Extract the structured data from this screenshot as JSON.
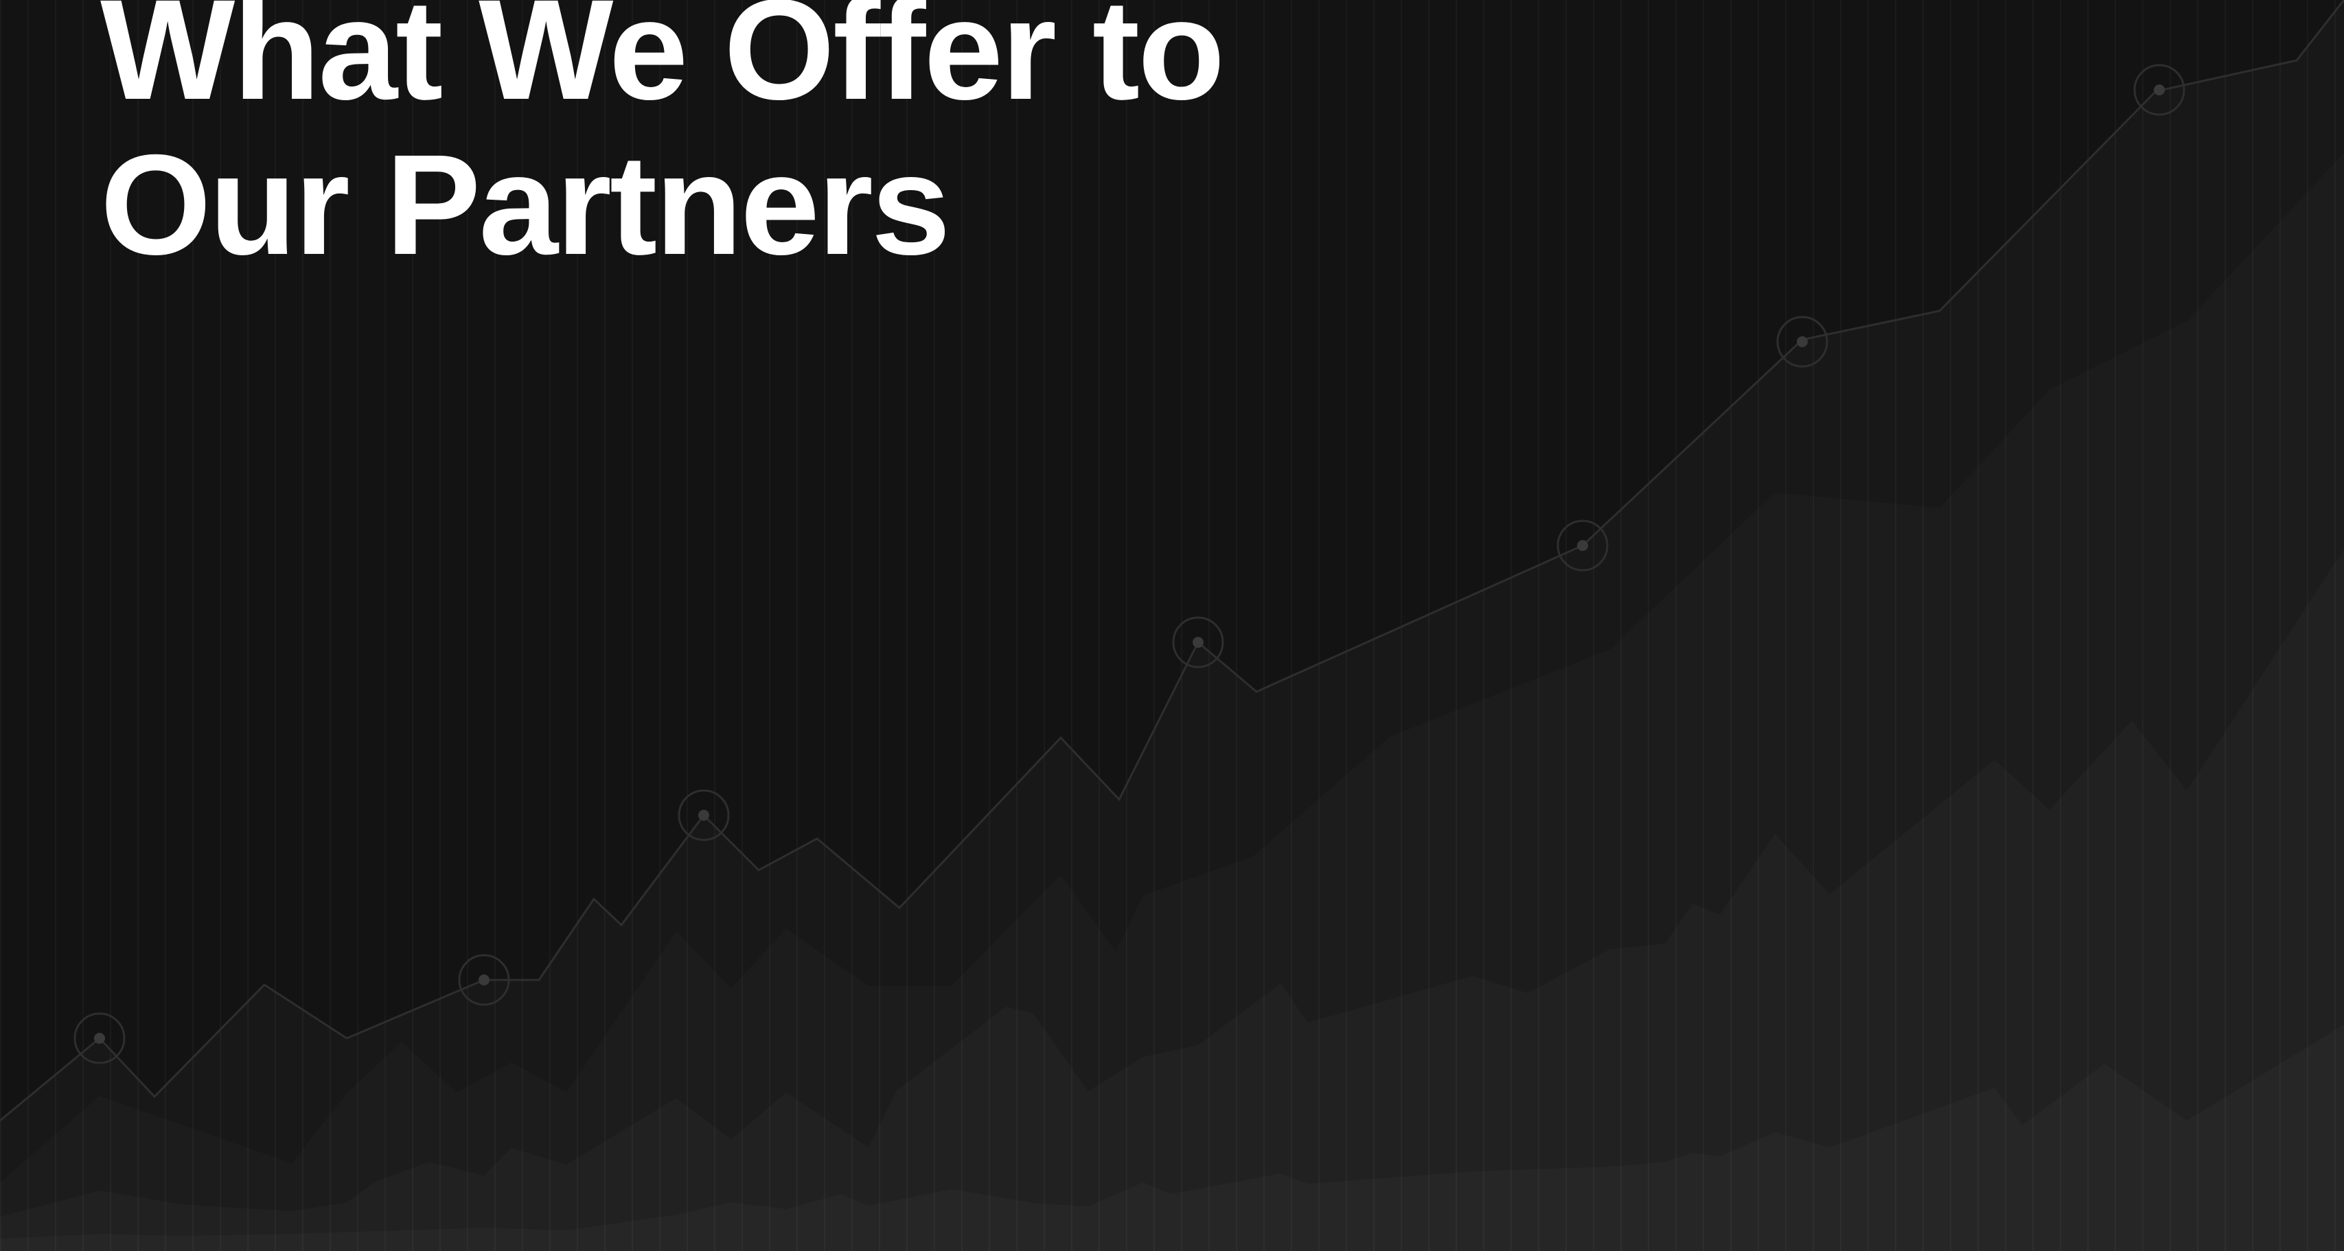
{
  "headline": {
    "line1": "What We Offer to",
    "line2": "Our Partners"
  },
  "colors": {
    "background": "#131313",
    "text": "#ffffff",
    "band_dark": "#181818",
    "band_mid": "#1c1c1c",
    "band_light": "#212121",
    "band_lightest": "#262626",
    "trend_line": "#2c2c2c",
    "marker": "#3a3a3a"
  }
}
